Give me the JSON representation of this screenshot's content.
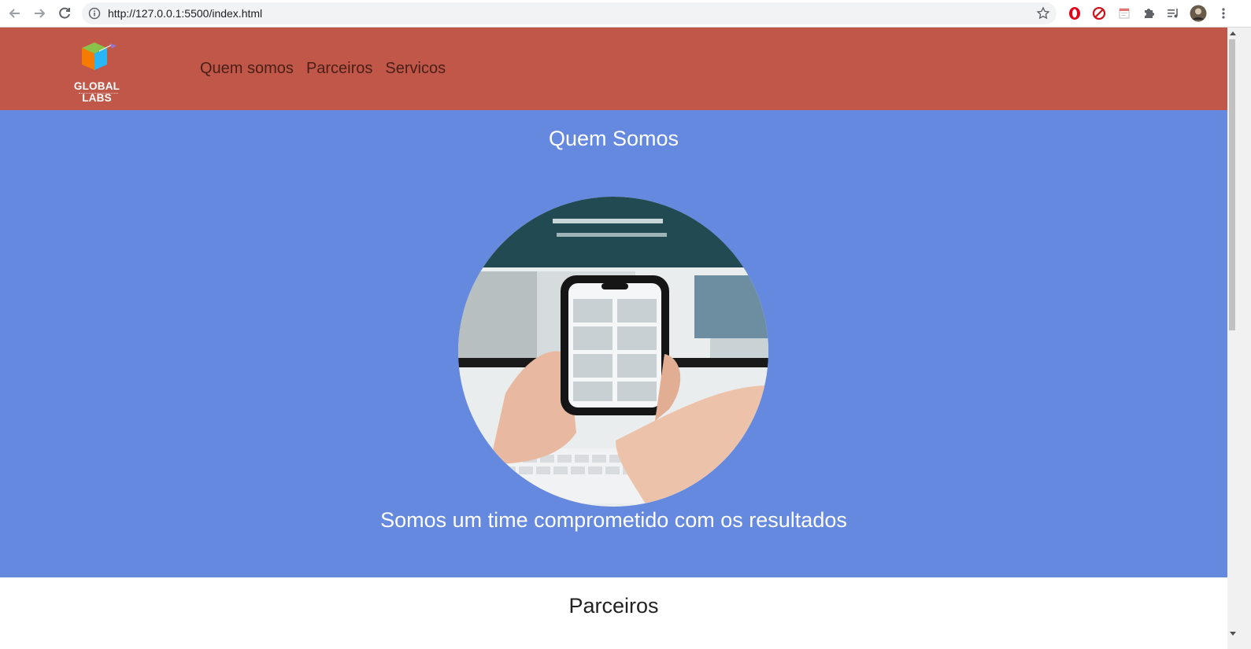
{
  "browser": {
    "url": "http://127.0.0.1:5500/index.html",
    "back_icon": "arrow-left-icon",
    "forward_icon": "arrow-right-icon",
    "reload_icon": "reload-icon",
    "info_icon": "info-icon",
    "bookmark_icon": "star-icon",
    "extensions": [
      "opera-icon",
      "block-icon",
      "calendar-icon",
      "puzzle-icon",
      "media-queue-icon",
      "avatar",
      "menu-icon"
    ]
  },
  "header": {
    "logo_text": "GLOBAL LABS",
    "logo_subtext": "STARTUP STUDIO",
    "nav": [
      {
        "label": "Quem somos"
      },
      {
        "label": "Parceiros"
      },
      {
        "label": "Servicos"
      }
    ],
    "colors": {
      "header_bg": "#c05748",
      "nav_text": "#4a1f18"
    }
  },
  "hero": {
    "title": "Quem Somos",
    "subtitle": "Somos um time comprometido com os resultados",
    "image_alt": "hands holding a smartphone in front of a laptop",
    "colors": {
      "bg": "#6589de"
    }
  },
  "partners": {
    "title": "Parceiros"
  }
}
